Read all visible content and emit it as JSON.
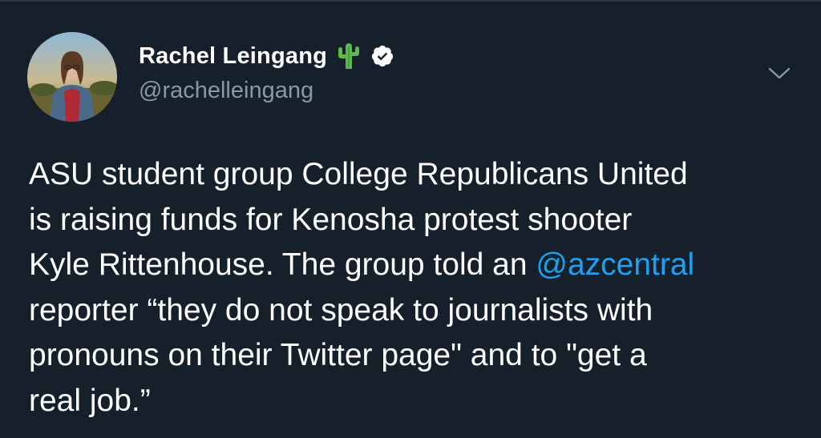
{
  "author": {
    "display_name": "Rachel Leingang",
    "handle": "@rachelleingang",
    "emoji_icon": "cactus-icon",
    "verified_icon": "verified-badge-icon",
    "avatar_icon": "avatar"
  },
  "menu": {
    "icon": "chevron-down-icon"
  },
  "tweet": {
    "line1": "ASU student group College Republicans United",
    "line2": "is raising funds for Kenosha protest shooter",
    "line3_text": "Kyle Rittenhouse. The group told an ",
    "line3_mention": "@azcentral",
    "line4": "reporter “they do not speak to journalists with",
    "line5": "pronouns on their Twitter page\" and to \"get a",
    "line6": "real job.”"
  },
  "colors": {
    "background": "#15202b",
    "text": "#ffffff",
    "secondary_text": "#8899a6",
    "link": "#1da1f2",
    "cactus": "#5fb74f"
  }
}
